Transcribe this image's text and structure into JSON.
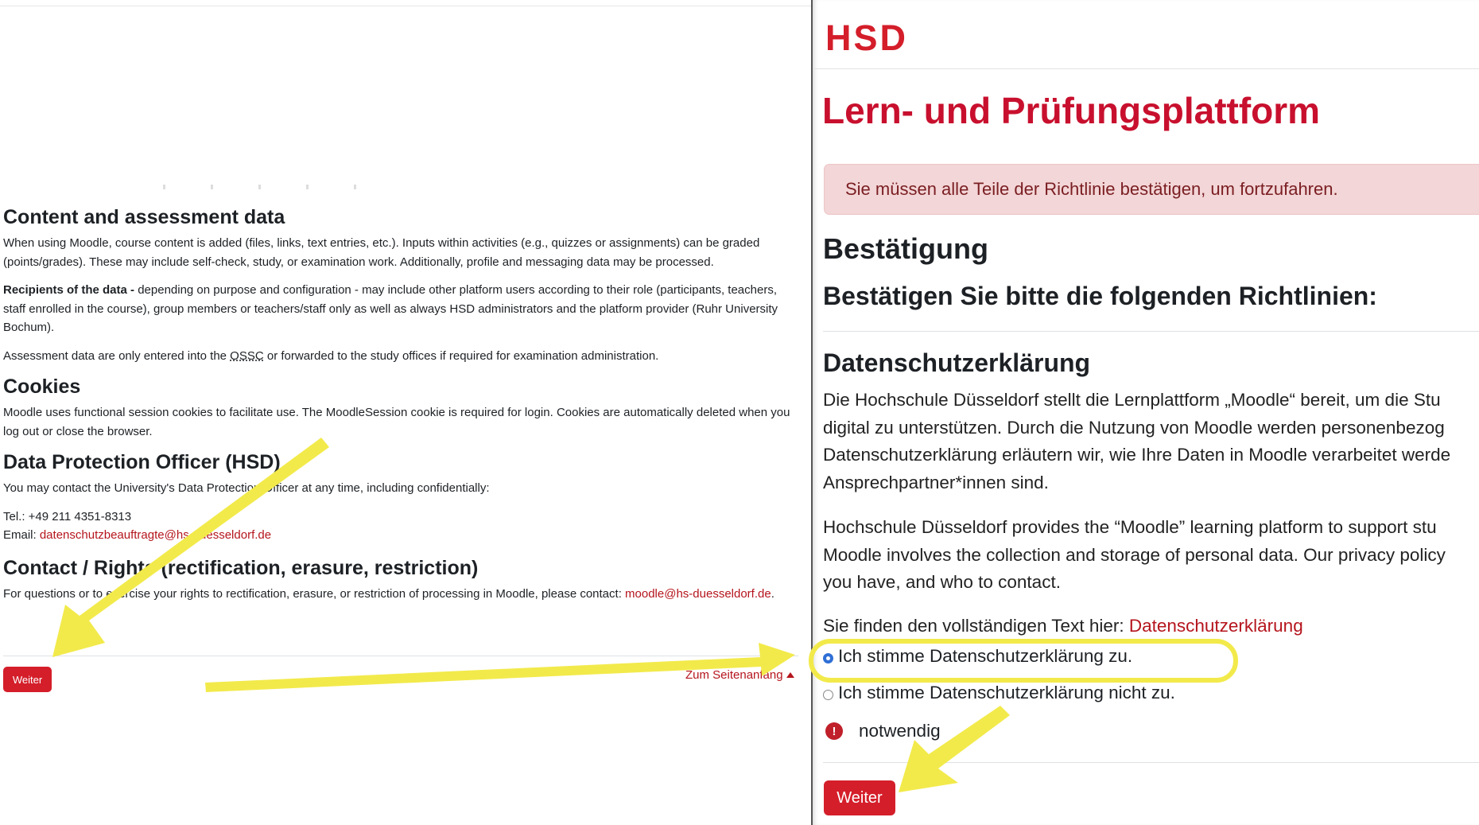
{
  "left": {
    "sections": [
      {
        "heading": "Content and assessment data",
        "paragraphs": [
          "When using Moodle, course content is added (files, links, text entries, etc.). Inputs within activities (e.g., quizzes or assignments) can be graded (points/grades). These may include self-check, study, or examination work. Additionally, profile and messaging data may be processed."
        ]
      },
      {
        "recipients_label": "Recipients of the data -",
        "recipients_text": " depending on purpose and configuration - may include other platform users according to their role (participants, teachers, staff enrolled in the course), group members or teachers/staff only as well as always HSD administrators and the platform provider (Ruhr University Bochum).",
        "assessment_pre": "Assessment data are only entered into the ",
        "assessment_abbr": "OSSC",
        "assessment_post": " or forwarded to the study offices if required for examination administration."
      }
    ],
    "cookies": {
      "heading": "Cookies",
      "text": "Moodle uses functional session cookies to facilitate use. The MoodleSession cookie is required for login. Cookies are automatically deleted when you log out or close the browser."
    },
    "dpo": {
      "heading": "Data Protection Officer (HSD)",
      "text": "You may contact the University's Data Protection Officer at any time, including confidentially:",
      "tel": "Tel.: +49 211 4351-8313",
      "email_label": "Email: ",
      "email": "datenschutzbeauftragte@hs-duesseldorf.de"
    },
    "contact": {
      "heading": "Contact / Rights (rectification, erasure, restriction)",
      "text": "For questions or to exercise your rights to rectification, erasure, or restriction of processing in Moodle, please contact: ",
      "email": "moodle@hs-duesseldorf.de",
      "end": "."
    },
    "continue_label": "Weiter",
    "to_top_label": "Zum Seitenanfang"
  },
  "right": {
    "logo": "HSD",
    "title": "Lern- und Prüfungsplattform",
    "alert": "Sie müssen alle Teile der Richtlinie bestätigen, um fortzufahren.",
    "heading": "Bestätigung",
    "subheading": "Bestätigen Sie bitte die folgenden Richtlinien:",
    "policy_heading": "Datenschutzerklärung",
    "para1": [
      "Die Hochschule Düsseldorf stellt die Lernplattform „Moodle“ bereit, um die Stu",
      "digital zu unterstützen. Durch die Nutzung von Moodle werden personenbezog",
      "Datenschutzerklärung erläutern wir, wie Ihre Daten in Moodle verarbeitet werde",
      "Ansprechpartner*innen sind."
    ],
    "para2": [
      "Hochschule Düsseldorf provides the “Moodle” learning platform to support stu",
      "Moodle involves the collection and storage of personal data. Our privacy policy",
      "you have, and who to contact."
    ],
    "fulltext_pre": "Sie finden den vollständigen Text hier: ",
    "fulltext_link": "Datenschutzerklärung",
    "agree_label": "Ich stimme Datenschutzerklärung zu.",
    "disagree_label": "Ich stimme Datenschutzerklärung nicht zu.",
    "required_label": "notwendig",
    "continue_label": "Weiter",
    "selected": "agree"
  },
  "colors": {
    "brand_red": "#d41e2a",
    "highlight_yellow": "#f2ea4b",
    "radio_blue": "#2f6fd6"
  }
}
